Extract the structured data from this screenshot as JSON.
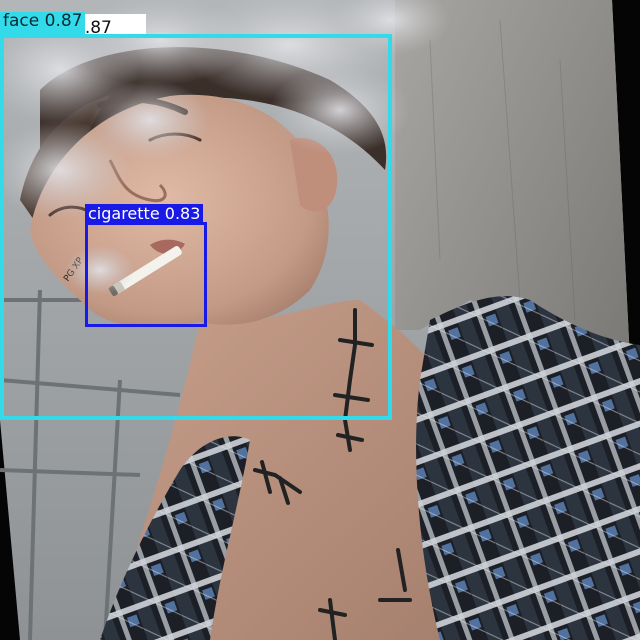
{
  "image": {
    "description_colors": {
      "wall_left": "#9ea2a2",
      "wall_right": "#8a8884",
      "skin": "#c9a28e",
      "hair": "#3b2f2a",
      "smoke": "#c8c8cc",
      "jacket_dark": "#1c1f26",
      "jacket_light": "#d8dce2",
      "jacket_blue": "#5b7fb3"
    }
  },
  "detections": [
    {
      "label": "face",
      "score": "0.87",
      "color": "#33dbea"
    },
    {
      "label": "cigarette",
      "score": "0.83",
      "color": "#1a1ae6"
    }
  ],
  "underlay_label": {
    "score": "0.87"
  }
}
